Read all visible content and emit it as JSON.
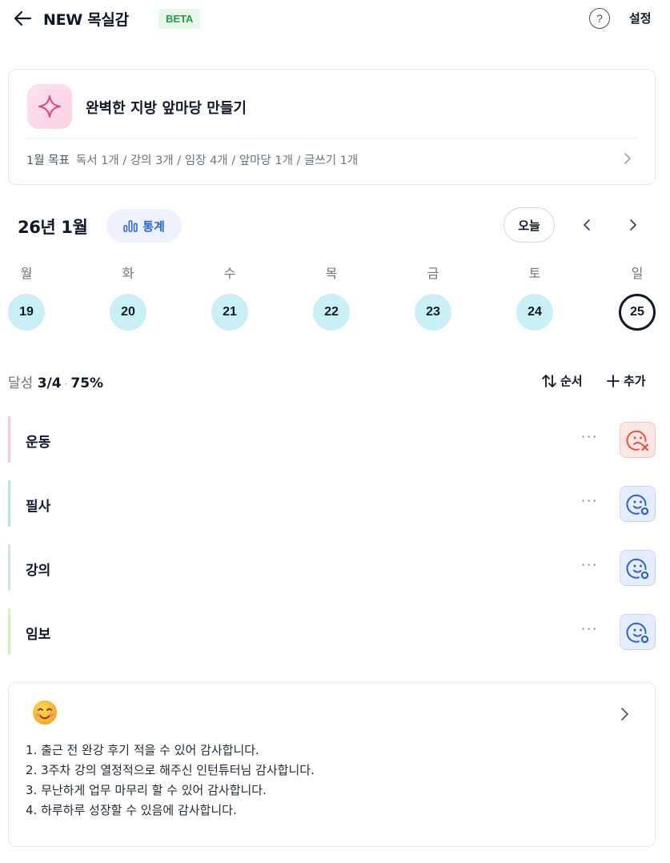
{
  "header": {
    "title": "NEW 목실감",
    "badge": "BETA",
    "help_label": "?",
    "settings_label": "설정"
  },
  "goal": {
    "icon": "sparkle-icon",
    "title": "완벽한 지방 앞마당 만들기",
    "month_label": "1월 목표",
    "summary": "독서 1개 / 강의 3개 / 임장 4개 / 앞마당 1개 / 글쓰기 1개"
  },
  "calendar": {
    "month_label": "26년 1월",
    "stats_label": "통계",
    "today_label": "오늘",
    "weekdays": [
      "월",
      "화",
      "수",
      "목",
      "금",
      "토",
      "일"
    ],
    "days": [
      "19",
      "20",
      "21",
      "22",
      "23",
      "24",
      "25"
    ],
    "selected_day": "25"
  },
  "progress": {
    "label": "달성",
    "count": "3/4",
    "separator": "·",
    "percent": "75%",
    "order_label": "순서",
    "add_label": "추가"
  },
  "habits": [
    {
      "name": "운동",
      "more": "···",
      "status": "failed",
      "icon": "sad-face-x-icon",
      "bar_color": "#f5c6dc"
    },
    {
      "name": "필사",
      "more": "···",
      "status": "done",
      "icon": "smile-face-check-icon",
      "bar_color": "#b8e9d6"
    },
    {
      "name": "강의",
      "more": "···",
      "status": "done",
      "icon": "smile-face-check-icon",
      "bar_color": "#cfe0f5"
    },
    {
      "name": "임보",
      "more": "···",
      "status": "done",
      "icon": "smile-face-check-icon",
      "bar_color": "#d4f0bb"
    }
  ],
  "gratitude": {
    "emoji": "smiling-face-icon",
    "items": [
      "1. 출근 전 완강 후기 적을 수 있어 감사합니다.",
      "2. 3주차 강의 열정적으로 해주신 인턴튜터님 감사합니다.",
      "3. 무난하게 업무 마무리 할 수 있어 감사합니다.",
      "4. 하루하루 성장할 수 있음에 감사합니다."
    ]
  },
  "colors": {
    "accent": "#2563eb",
    "day_circle": "#c9f0f7",
    "beta_bg": "#e7f8e9",
    "beta_text": "#1f9b49",
    "fail": "#e4543f",
    "done": "#2f5fd0"
  }
}
